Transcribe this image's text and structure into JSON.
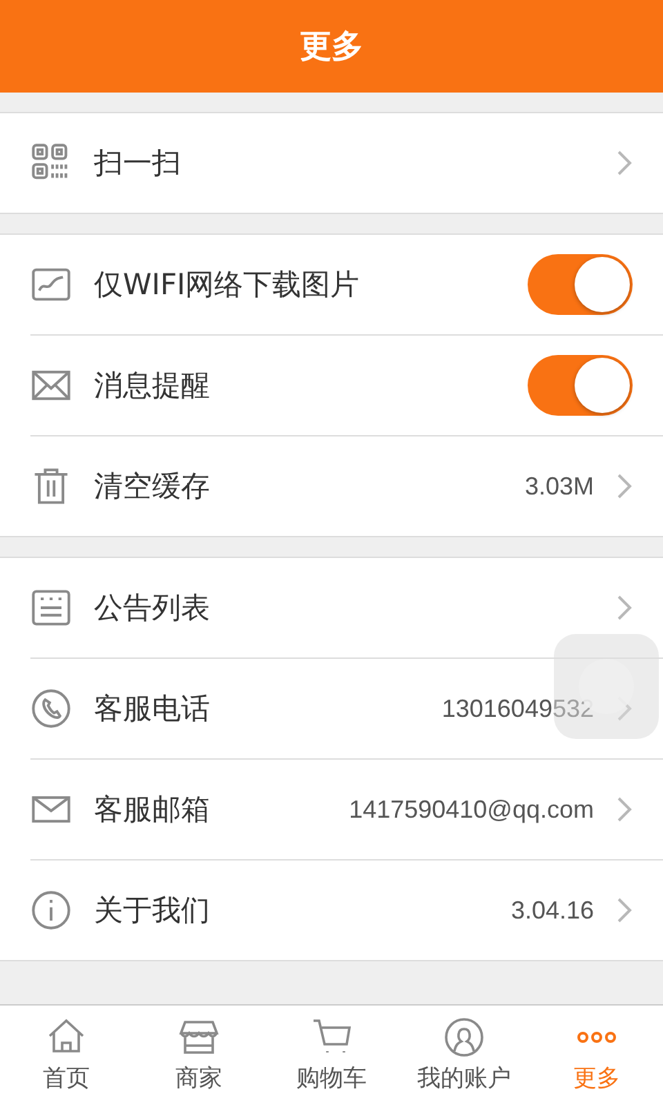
{
  "header": {
    "title": "更多"
  },
  "groups": [
    {
      "rows": [
        {
          "kind": "link",
          "label": "扫一扫"
        }
      ]
    },
    {
      "rows": [
        {
          "kind": "toggle",
          "label": "仅WIFI网络下载图片",
          "on": true
        },
        {
          "kind": "toggle",
          "label": "消息提醒",
          "on": true
        },
        {
          "kind": "link",
          "label": "清空缓存",
          "value": "3.03M"
        }
      ]
    },
    {
      "rows": [
        {
          "kind": "link",
          "label": "公告列表"
        },
        {
          "kind": "link",
          "label": "客服电话",
          "value": "13016049532"
        },
        {
          "kind": "link",
          "label": "客服邮箱",
          "value": "1417590410@qq.com"
        },
        {
          "kind": "link",
          "label": "关于我们",
          "value": "3.04.16"
        }
      ]
    }
  ],
  "tabs": [
    {
      "label": "首页",
      "selected": false
    },
    {
      "label": "商家",
      "selected": false
    },
    {
      "label": "购物车",
      "selected": false
    },
    {
      "label": "我的账户",
      "selected": false
    },
    {
      "label": "更多",
      "selected": true
    }
  ]
}
